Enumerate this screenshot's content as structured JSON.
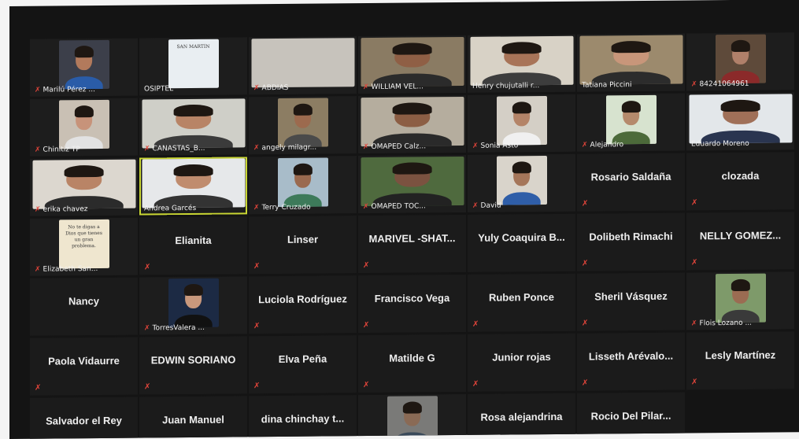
{
  "accent_speaker_color": "#c9d633",
  "muted_icon_color": "#e0443a",
  "muted_icon": "mic-muted-icon",
  "participants": [
    {
      "name": "Marilú Pérez ...",
      "video": true,
      "muted": true,
      "skin": "#b27a5c",
      "bg": "#3c3f4a",
      "shirt": "#2a5ca8"
    },
    {
      "name": "OSIPTEL",
      "video": true,
      "muted": false,
      "bg": "#e9eef2",
      "poster": true,
      "poster_title": "SAN MARTÍN"
    },
    {
      "name": "ABDIAS",
      "video": true,
      "muted": true,
      "bg": "#c7c3bc",
      "wide": true,
      "empty": true
    },
    {
      "name": "WILLIAM VEL...",
      "video": true,
      "muted": true,
      "skin": "#8f5f45",
      "bg": "#8a7b63",
      "shirt": "#2b2b2b",
      "wide": true
    },
    {
      "name": "Henry chujutalli r...",
      "video": true,
      "muted": false,
      "skin": "#a87458",
      "bg": "#d8d2c6",
      "shirt": "#3d3d3d",
      "wide": true
    },
    {
      "name": "Tatiana Piccini",
      "video": true,
      "muted": false,
      "skin": "#c8967a",
      "bg": "#9c8a6d",
      "shirt": "#2c2c2c",
      "wide": true
    },
    {
      "name": "84241064961",
      "video": true,
      "muted": true,
      "skin": "#b0806a",
      "bg": "#5e4a3a",
      "shirt": "#8b2a2a"
    },
    {
      "name": "Chinitiz TP",
      "video": true,
      "muted": true,
      "skin": "#c7937a",
      "bg": "#c9c0b4",
      "shirt": "#e2e2e2"
    },
    {
      "name": "CANASTAS_B...",
      "video": true,
      "muted": true,
      "skin": "#b88466",
      "bg": "#cfcfc8",
      "shirt": "#3b3b3b",
      "wide": true
    },
    {
      "name": "angely milagr...",
      "video": true,
      "muted": true,
      "skin": "#9c6a4e",
      "bg": "#8c7d63",
      "shirt": "#4a4a4a"
    },
    {
      "name": "OMAPED Calz...",
      "video": true,
      "muted": true,
      "skin": "#8c5e44",
      "bg": "#b5ad9e",
      "shirt": "#2a2a2a",
      "wide": true
    },
    {
      "name": "Sonia Asto",
      "video": true,
      "muted": true,
      "skin": "#b48468",
      "bg": "#d4cfc6",
      "shirt": "#f0f0f0"
    },
    {
      "name": "Alejandro",
      "video": true,
      "muted": true,
      "skin": "#b58a6c",
      "bg": "#d7e3cf",
      "shirt": "#4c6a3a"
    },
    {
      "name": "Eduardo Moreno",
      "video": true,
      "muted": false,
      "skin": "#a07058",
      "bg": "#e3e7ea",
      "shirt": "#2a3550",
      "wide": true
    },
    {
      "name": "erika chavez",
      "video": true,
      "muted": true,
      "skin": "#b98466",
      "bg": "#dcd7cf",
      "shirt": "#2b2b2b",
      "wide": true
    },
    {
      "name": "Andrea Garcés",
      "video": true,
      "muted": false,
      "active": true,
      "skin": "#c08c6e",
      "bg": "#e6e8ea",
      "shirt": "#333333",
      "wide": true
    },
    {
      "name": "Terry Cruzado",
      "video": true,
      "muted": true,
      "skin": "#9a6a4f",
      "bg": "#a8bcc9",
      "shirt": "#3d7a5a"
    },
    {
      "name": "OMAPED TOC...",
      "video": true,
      "muted": true,
      "skin": "#7b5240",
      "bg": "#4f6a3e",
      "shirt": "#222222",
      "wide": true
    },
    {
      "name": "David",
      "video": true,
      "muted": true,
      "skin": "#a5765a",
      "bg": "#d9d4cb",
      "shirt": "#2f5ea8"
    },
    {
      "name": "Rosario Saldaña",
      "video": false,
      "muted": true
    },
    {
      "name": "clozada",
      "video": false,
      "muted": true
    },
    {
      "name": "Elizabeth San...",
      "video": true,
      "muted": true,
      "bg": "#efe6cf",
      "poster": true,
      "poster_title": "No te digas a Dios que tienes un gran problema."
    },
    {
      "name": "Elianita",
      "video": false,
      "muted": true
    },
    {
      "name": "Linser",
      "video": false,
      "muted": true
    },
    {
      "name": "MARIVEL -SHAT...",
      "video": false,
      "muted": true
    },
    {
      "name": "Yuly Coaquira B...",
      "video": false,
      "muted": false
    },
    {
      "name": "Dolibeth Rimachi",
      "video": false,
      "muted": true
    },
    {
      "name": "NELLY GOMEZ...",
      "video": false,
      "muted": true
    },
    {
      "name": "Nancy",
      "video": false,
      "muted": false
    },
    {
      "name": "TorresValera ...",
      "video": true,
      "muted": true,
      "skin": "#c9987c",
      "bg": "#1c2a44",
      "shirt": "#111111"
    },
    {
      "name": "Luciola Rodríguez",
      "video": false,
      "muted": true
    },
    {
      "name": "Francisco Vega",
      "video": false,
      "muted": true
    },
    {
      "name": "Ruben Ponce",
      "video": false,
      "muted": true
    },
    {
      "name": "Sheril Vásquez",
      "video": false,
      "muted": true
    },
    {
      "name": "Flois Lozano ...",
      "video": true,
      "muted": true,
      "skin": "#9b6c52",
      "bg": "#7e9a6a",
      "shirt": "#3a3a3a"
    },
    {
      "name": "Paola Vidaurre",
      "video": false,
      "muted": true
    },
    {
      "name": "EDWIN SORIANO",
      "video": false,
      "muted": true
    },
    {
      "name": "Elva Peña",
      "video": false,
      "muted": true
    },
    {
      "name": "Matilde G",
      "video": false,
      "muted": true
    },
    {
      "name": "Junior rojas",
      "video": false,
      "muted": true
    },
    {
      "name": "Lisseth Arévalo...",
      "video": false,
      "muted": true
    },
    {
      "name": "Lesly Martínez",
      "video": false,
      "muted": true
    },
    {
      "name": "Salvador el Rey",
      "video": false,
      "muted": false
    },
    {
      "name": "Juan Manuel",
      "video": false,
      "muted": false
    },
    {
      "name": "dina chinchay t...",
      "video": false,
      "muted": false
    },
    {
      "name": "",
      "video": true,
      "muted": false,
      "skin": "#8a6a55",
      "bg": "#7a7a78",
      "shirt": "#3a4a5a"
    },
    {
      "name": "Rosa alejandrina",
      "video": false,
      "muted": false
    },
    {
      "name": "Rocio Del Pilar...",
      "video": false,
      "muted": false
    }
  ]
}
